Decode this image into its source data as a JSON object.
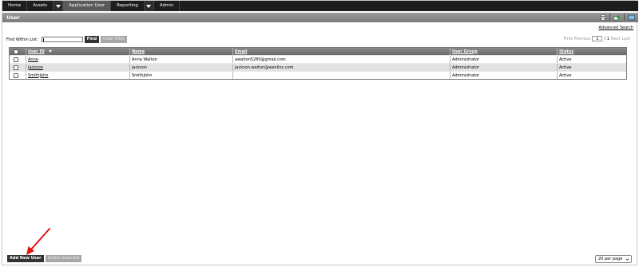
{
  "nav": {
    "items": [
      {
        "label": "Home",
        "active": false,
        "dropdown": false
      },
      {
        "label": "Assets",
        "active": false,
        "dropdown": true
      },
      {
        "label": "Application User",
        "active": true,
        "dropdown": false
      },
      {
        "label": "Reporting",
        "active": false,
        "dropdown": true
      },
      {
        "label": "Admin",
        "active": false,
        "dropdown": false
      }
    ]
  },
  "page": {
    "title": "User",
    "advanced_search": "Advanced Search",
    "toolbar_icons": [
      "print-icon",
      "add-icon",
      "export-icon"
    ]
  },
  "find": {
    "label": "Find Within List:",
    "value": "",
    "find_button": "Find",
    "clear_button": "Clear Filter"
  },
  "pager": {
    "first": "First",
    "previous": "Previous",
    "current_page": "1",
    "of_text": "/ 1",
    "next": "Next",
    "last": "Last"
  },
  "table": {
    "columns": [
      "User ID",
      "Name",
      "Email",
      "User Group",
      "Status"
    ],
    "rows": [
      {
        "user_id": "Anne",
        "name": "Anna Walton",
        "email": "awalton5280@gmail.com",
        "group": "Administrator",
        "status": "Active"
      },
      {
        "user_id": "Jackson",
        "name": "jackson",
        "email": "jackson.walton@wenlinc.com",
        "group": "Administrator",
        "status": "Active"
      },
      {
        "user_id": "SmithJohn",
        "name": "SmithJohn",
        "email": "",
        "group": "Administrator",
        "status": "Active"
      }
    ]
  },
  "bottom": {
    "add_button": "Add New User",
    "delete_button": "Delete Selected",
    "per_page": "20 per page"
  },
  "colors": {
    "nav_bg": "#1d1d1d",
    "active_tab": "#5a5a5a",
    "header_grey": "#7a7a7a",
    "annotation_red": "#e3140e"
  }
}
